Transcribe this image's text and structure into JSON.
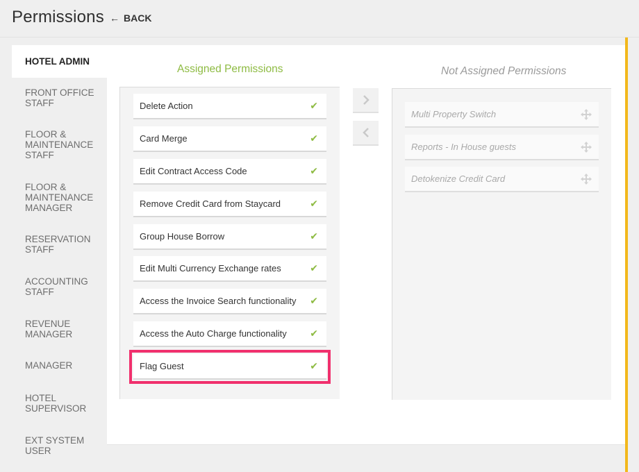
{
  "header": {
    "title": "Permissions",
    "back_label": "BACK"
  },
  "sidebar": {
    "items": [
      {
        "label": "HOTEL ADMIN",
        "active": true
      },
      {
        "label": "FRONT OFFICE STAFF"
      },
      {
        "label": "FLOOR & MAINTENANCE STAFF"
      },
      {
        "label": "FLOOR & MAINTENANCE MANAGER"
      },
      {
        "label": "RESERVATION STAFF"
      },
      {
        "label": "ACCOUNTING STAFF"
      },
      {
        "label": "REVENUE MANAGER"
      },
      {
        "label": "MANAGER"
      },
      {
        "label": "HOTEL SUPERVISOR"
      },
      {
        "label": "EXT SYSTEM USER"
      }
    ]
  },
  "assigned": {
    "title": "Assigned Permissions",
    "items": [
      "Delete Action",
      "Card Merge",
      "Edit Contract Access Code",
      "Remove Credit Card from Staycard",
      "Group House Borrow",
      "Edit Multi Currency Exchange rates",
      "Access the Invoice Search functionality",
      "Access the Auto Charge functionality",
      "Flag Guest"
    ],
    "check_icon": "checkmark-icon",
    "highlighted_item": "Flag Guest"
  },
  "not_assigned": {
    "title": "Not Assigned Permissions",
    "items": [
      "Multi Property Switch",
      "Reports - In House guests",
      "Detokenize Credit Card"
    ],
    "drag_icon": "move-icon"
  },
  "colors": {
    "assigned_title": "#8ebb43",
    "check": "#8ebb43",
    "highlight": "#f0306d",
    "accent_bar": "#f2b81c"
  }
}
